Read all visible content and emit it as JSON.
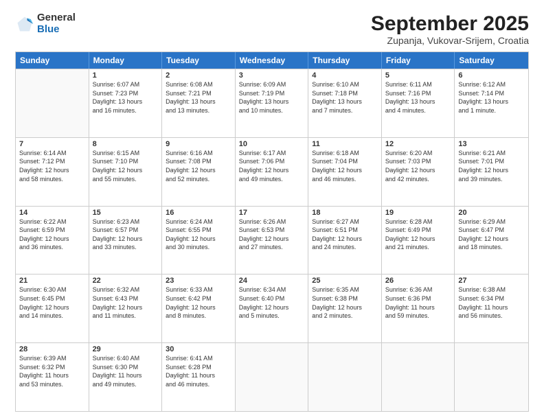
{
  "logo": {
    "general": "General",
    "blue": "Blue"
  },
  "title": "September 2025",
  "subtitle": "Zupanja, Vukovar-Srijem, Croatia",
  "days": [
    "Sunday",
    "Monday",
    "Tuesday",
    "Wednesday",
    "Thursday",
    "Friday",
    "Saturday"
  ],
  "weeks": [
    [
      {
        "day": "",
        "info": ""
      },
      {
        "day": "1",
        "info": "Sunrise: 6:07 AM\nSunset: 7:23 PM\nDaylight: 13 hours\nand 16 minutes."
      },
      {
        "day": "2",
        "info": "Sunrise: 6:08 AM\nSunset: 7:21 PM\nDaylight: 13 hours\nand 13 minutes."
      },
      {
        "day": "3",
        "info": "Sunrise: 6:09 AM\nSunset: 7:19 PM\nDaylight: 13 hours\nand 10 minutes."
      },
      {
        "day": "4",
        "info": "Sunrise: 6:10 AM\nSunset: 7:18 PM\nDaylight: 13 hours\nand 7 minutes."
      },
      {
        "day": "5",
        "info": "Sunrise: 6:11 AM\nSunset: 7:16 PM\nDaylight: 13 hours\nand 4 minutes."
      },
      {
        "day": "6",
        "info": "Sunrise: 6:12 AM\nSunset: 7:14 PM\nDaylight: 13 hours\nand 1 minute."
      }
    ],
    [
      {
        "day": "7",
        "info": "Sunrise: 6:14 AM\nSunset: 7:12 PM\nDaylight: 12 hours\nand 58 minutes."
      },
      {
        "day": "8",
        "info": "Sunrise: 6:15 AM\nSunset: 7:10 PM\nDaylight: 12 hours\nand 55 minutes."
      },
      {
        "day": "9",
        "info": "Sunrise: 6:16 AM\nSunset: 7:08 PM\nDaylight: 12 hours\nand 52 minutes."
      },
      {
        "day": "10",
        "info": "Sunrise: 6:17 AM\nSunset: 7:06 PM\nDaylight: 12 hours\nand 49 minutes."
      },
      {
        "day": "11",
        "info": "Sunrise: 6:18 AM\nSunset: 7:04 PM\nDaylight: 12 hours\nand 46 minutes."
      },
      {
        "day": "12",
        "info": "Sunrise: 6:20 AM\nSunset: 7:03 PM\nDaylight: 12 hours\nand 42 minutes."
      },
      {
        "day": "13",
        "info": "Sunrise: 6:21 AM\nSunset: 7:01 PM\nDaylight: 12 hours\nand 39 minutes."
      }
    ],
    [
      {
        "day": "14",
        "info": "Sunrise: 6:22 AM\nSunset: 6:59 PM\nDaylight: 12 hours\nand 36 minutes."
      },
      {
        "day": "15",
        "info": "Sunrise: 6:23 AM\nSunset: 6:57 PM\nDaylight: 12 hours\nand 33 minutes."
      },
      {
        "day": "16",
        "info": "Sunrise: 6:24 AM\nSunset: 6:55 PM\nDaylight: 12 hours\nand 30 minutes."
      },
      {
        "day": "17",
        "info": "Sunrise: 6:26 AM\nSunset: 6:53 PM\nDaylight: 12 hours\nand 27 minutes."
      },
      {
        "day": "18",
        "info": "Sunrise: 6:27 AM\nSunset: 6:51 PM\nDaylight: 12 hours\nand 24 minutes."
      },
      {
        "day": "19",
        "info": "Sunrise: 6:28 AM\nSunset: 6:49 PM\nDaylight: 12 hours\nand 21 minutes."
      },
      {
        "day": "20",
        "info": "Sunrise: 6:29 AM\nSunset: 6:47 PM\nDaylight: 12 hours\nand 18 minutes."
      }
    ],
    [
      {
        "day": "21",
        "info": "Sunrise: 6:30 AM\nSunset: 6:45 PM\nDaylight: 12 hours\nand 14 minutes."
      },
      {
        "day": "22",
        "info": "Sunrise: 6:32 AM\nSunset: 6:43 PM\nDaylight: 12 hours\nand 11 minutes."
      },
      {
        "day": "23",
        "info": "Sunrise: 6:33 AM\nSunset: 6:42 PM\nDaylight: 12 hours\nand 8 minutes."
      },
      {
        "day": "24",
        "info": "Sunrise: 6:34 AM\nSunset: 6:40 PM\nDaylight: 12 hours\nand 5 minutes."
      },
      {
        "day": "25",
        "info": "Sunrise: 6:35 AM\nSunset: 6:38 PM\nDaylight: 12 hours\nand 2 minutes."
      },
      {
        "day": "26",
        "info": "Sunrise: 6:36 AM\nSunset: 6:36 PM\nDaylight: 11 hours\nand 59 minutes."
      },
      {
        "day": "27",
        "info": "Sunrise: 6:38 AM\nSunset: 6:34 PM\nDaylight: 11 hours\nand 56 minutes."
      }
    ],
    [
      {
        "day": "28",
        "info": "Sunrise: 6:39 AM\nSunset: 6:32 PM\nDaylight: 11 hours\nand 53 minutes."
      },
      {
        "day": "29",
        "info": "Sunrise: 6:40 AM\nSunset: 6:30 PM\nDaylight: 11 hours\nand 49 minutes."
      },
      {
        "day": "30",
        "info": "Sunrise: 6:41 AM\nSunset: 6:28 PM\nDaylight: 11 hours\nand 46 minutes."
      },
      {
        "day": "",
        "info": ""
      },
      {
        "day": "",
        "info": ""
      },
      {
        "day": "",
        "info": ""
      },
      {
        "day": "",
        "info": ""
      }
    ]
  ]
}
